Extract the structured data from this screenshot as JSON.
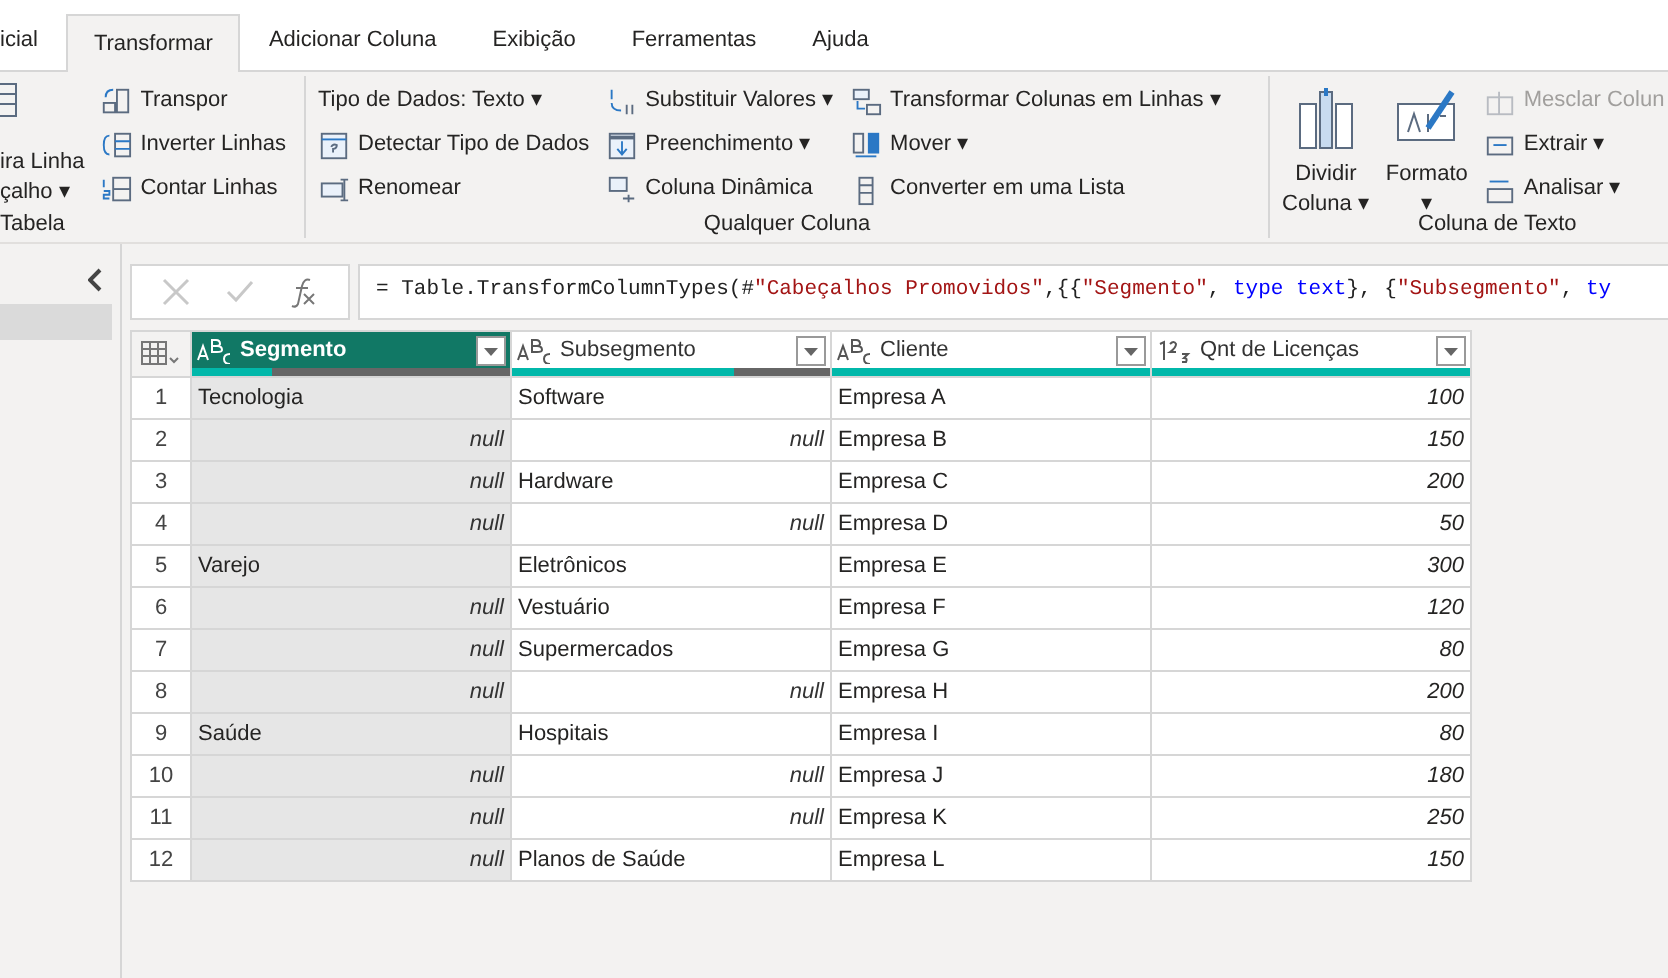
{
  "tabs": [
    {
      "label": "icial",
      "selected": false
    },
    {
      "label": "Transformar",
      "selected": true
    },
    {
      "label": "Adicionar Coluna",
      "selected": false
    },
    {
      "label": "Exibição",
      "selected": false
    },
    {
      "label": "Ferramentas",
      "selected": false
    },
    {
      "label": "Ajuda",
      "selected": false
    }
  ],
  "ribbon": {
    "groups": [
      {
        "label": "Tabela",
        "big": [
          {
            "lines": [
              "ira Linha",
              "çalho ▾"
            ]
          }
        ],
        "columns": [
          [
            {
              "label": "Transpor",
              "disabled": false
            },
            {
              "label": "Inverter Linhas",
              "disabled": false
            },
            {
              "label": "Contar Linhas",
              "disabled": false
            }
          ]
        ]
      },
      {
        "label": "Qualquer Coluna",
        "columns": [
          [
            {
              "label": "Tipo de Dados: Texto ▾",
              "disabled": false
            },
            {
              "label": "Detectar Tipo de Dados",
              "disabled": false
            },
            {
              "label": "Renomear",
              "disabled": false
            }
          ],
          [
            {
              "label": "Substituir Valores ▾",
              "disabled": false
            },
            {
              "label": "Preenchimento ▾",
              "disabled": false
            },
            {
              "label": "Coluna Dinâmica",
              "disabled": false
            }
          ],
          [
            {
              "label": "Transformar Colunas em Linhas ▾",
              "disabled": false
            },
            {
              "label": "Mover ▾",
              "disabled": false
            },
            {
              "label": "Converter em uma Lista",
              "disabled": false
            }
          ]
        ]
      },
      {
        "label": "Coluna de Texto",
        "big": [
          {
            "lines": [
              "Dividir",
              "Coluna ▾"
            ]
          },
          {
            "lines": [
              "Formato",
              "▾"
            ]
          }
        ],
        "columns": [
          [
            {
              "label": "Mesclar Colun",
              "disabled": true
            },
            {
              "label": "Extrair ▾",
              "disabled": false
            },
            {
              "label": "Analisar ▾",
              "disabled": false
            }
          ]
        ]
      }
    ]
  },
  "formula": {
    "segments": [
      {
        "kind": "plain",
        "text": "= Table.TransformColumnTypes(#"
      },
      {
        "kind": "string",
        "text": "\"Cabeçalhos Promovidos\""
      },
      {
        "kind": "plain",
        "text": ",{{"
      },
      {
        "kind": "string",
        "text": "\"Segmento\""
      },
      {
        "kind": "plain",
        "text": ", "
      },
      {
        "kind": "keyword",
        "text": "type text"
      },
      {
        "kind": "plain",
        "text": "}, {"
      },
      {
        "kind": "string",
        "text": "\"Subsegmento\""
      },
      {
        "kind": "plain",
        "text": ", "
      },
      {
        "kind": "keyword",
        "text": "ty"
      }
    ]
  },
  "table": {
    "columns": [
      {
        "kind": "text",
        "name": "Segmento",
        "selected": true,
        "level": 0.25
      },
      {
        "kind": "text",
        "name": "Subsegmento",
        "selected": false,
        "level": 0.7
      },
      {
        "kind": "text",
        "name": "Cliente",
        "selected": false,
        "level": 1
      },
      {
        "kind": "number",
        "name": "Qnt de Licenças",
        "selected": false,
        "level": 1
      }
    ],
    "rows": [
      {
        "n": "1",
        "cells": [
          {
            "text": "Tecnologia",
            "null": false
          },
          {
            "text": "Software",
            "null": false
          },
          {
            "text": "Empresa A",
            "null": false
          },
          {
            "text": "100",
            "null": false
          }
        ]
      },
      {
        "n": "2",
        "cells": [
          {
            "text": "null",
            "null": true
          },
          {
            "text": "null",
            "null": true
          },
          {
            "text": "Empresa B",
            "null": false
          },
          {
            "text": "150",
            "null": false
          }
        ]
      },
      {
        "n": "3",
        "cells": [
          {
            "text": "null",
            "null": true
          },
          {
            "text": "Hardware",
            "null": false
          },
          {
            "text": "Empresa C",
            "null": false
          },
          {
            "text": "200",
            "null": false
          }
        ]
      },
      {
        "n": "4",
        "cells": [
          {
            "text": "null",
            "null": true
          },
          {
            "text": "null",
            "null": true
          },
          {
            "text": "Empresa D",
            "null": false
          },
          {
            "text": "50",
            "null": false
          }
        ]
      },
      {
        "n": "5",
        "cells": [
          {
            "text": "Varejo",
            "null": false
          },
          {
            "text": "Eletrônicos",
            "null": false
          },
          {
            "text": "Empresa E",
            "null": false
          },
          {
            "text": "300",
            "null": false
          }
        ]
      },
      {
        "n": "6",
        "cells": [
          {
            "text": "null",
            "null": true
          },
          {
            "text": "Vestuário",
            "null": false
          },
          {
            "text": "Empresa F",
            "null": false
          },
          {
            "text": "120",
            "null": false
          }
        ]
      },
      {
        "n": "7",
        "cells": [
          {
            "text": "null",
            "null": true
          },
          {
            "text": "Supermercados",
            "null": false
          },
          {
            "text": "Empresa G",
            "null": false
          },
          {
            "text": "80",
            "null": false
          }
        ]
      },
      {
        "n": "8",
        "cells": [
          {
            "text": "null",
            "null": true
          },
          {
            "text": "null",
            "null": true
          },
          {
            "text": "Empresa H",
            "null": false
          },
          {
            "text": "200",
            "null": false
          }
        ]
      },
      {
        "n": "9",
        "cells": [
          {
            "text": "Saúde",
            "null": false
          },
          {
            "text": "Hospitais",
            "null": false
          },
          {
            "text": "Empresa I",
            "null": false
          },
          {
            "text": "80",
            "null": false
          }
        ]
      },
      {
        "n": "10",
        "cells": [
          {
            "text": "null",
            "null": true
          },
          {
            "text": "null",
            "null": true
          },
          {
            "text": "Empresa J",
            "null": false
          },
          {
            "text": "180",
            "null": false
          }
        ]
      },
      {
        "n": "11",
        "cells": [
          {
            "text": "null",
            "null": true
          },
          {
            "text": "null",
            "null": true
          },
          {
            "text": "Empresa K",
            "null": false
          },
          {
            "text": "250",
            "null": false
          }
        ]
      },
      {
        "n": "12",
        "cells": [
          {
            "text": "null",
            "null": true
          },
          {
            "text": "Planos de Saúde",
            "null": false
          },
          {
            "text": "Empresa L",
            "null": false
          },
          {
            "text": "150",
            "null": false
          }
        ]
      }
    ]
  }
}
